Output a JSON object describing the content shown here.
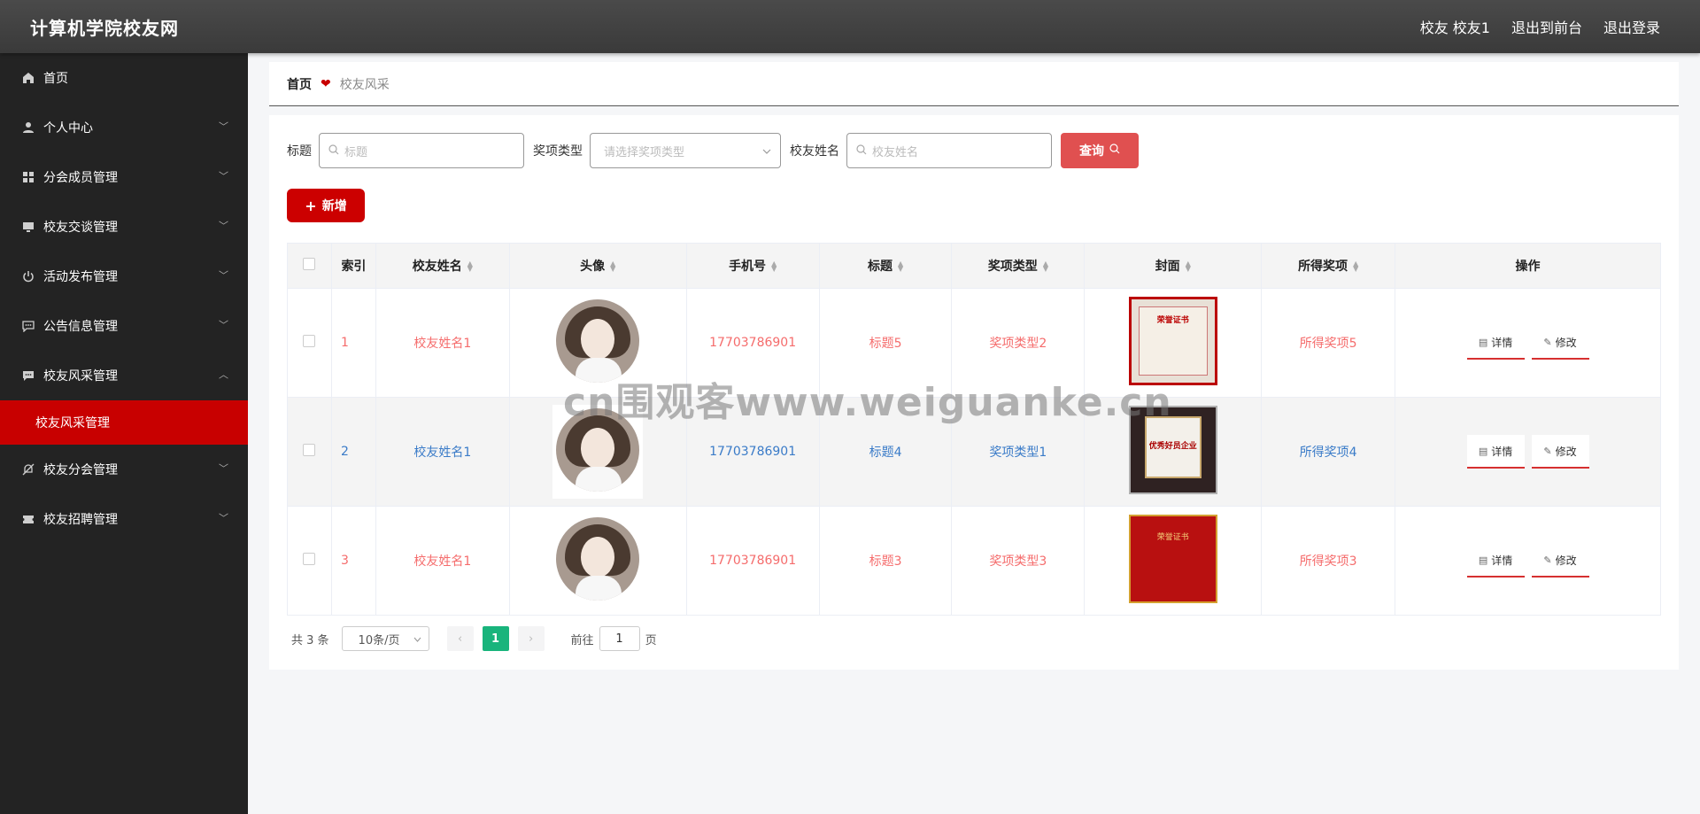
{
  "header": {
    "brand": "计算机学院校友网",
    "user_label": "校友 校友1",
    "to_front_label": "退出到前台",
    "logout_label": "退出登录"
  },
  "sidebar": {
    "items": [
      {
        "label": "首页",
        "icon": "home-icon"
      },
      {
        "label": "个人中心",
        "icon": "user-icon"
      },
      {
        "label": "分会成员管理",
        "icon": "grid-icon"
      },
      {
        "label": "校友交谈管理",
        "icon": "monitor-icon"
      },
      {
        "label": "活动发布管理",
        "icon": "power-icon"
      },
      {
        "label": "公告信息管理",
        "icon": "chat-icon"
      },
      {
        "label": "校友风采管理",
        "icon": "message-icon"
      },
      {
        "label": "校友分会管理",
        "icon": "bell-off-icon"
      },
      {
        "label": "校友招聘管理",
        "icon": "ticket-icon"
      }
    ],
    "active_sub": "校友风采管理"
  },
  "breadcrumb": {
    "home": "首页",
    "current": "校友风采"
  },
  "search": {
    "title_label": "标题",
    "title_placeholder": "标题",
    "award_type_label": "奖项类型",
    "award_type_placeholder": "请选择奖项类型",
    "name_label": "校友姓名",
    "name_placeholder": "校友姓名",
    "query_label": "查询"
  },
  "add_label": "新增",
  "table": {
    "headers": [
      "索引",
      "校友姓名",
      "头像",
      "手机号",
      "标题",
      "奖项类型",
      "封面",
      "所得奖项",
      "操作"
    ],
    "rows": [
      {
        "index": "1",
        "name": "校友姓名1",
        "phone": "17703786901",
        "title": "标题5",
        "award_type": "奖项类型2",
        "award": "所得奖项5",
        "cover_text": "荣誉证书"
      },
      {
        "index": "2",
        "name": "校友姓名1",
        "phone": "17703786901",
        "title": "标题4",
        "award_type": "奖项类型1",
        "award": "所得奖项4",
        "cover_text": "优秀好员企业"
      },
      {
        "index": "3",
        "name": "校友姓名1",
        "phone": "17703786901",
        "title": "标题3",
        "award_type": "奖项类型3",
        "award": "所得奖项3",
        "cover_text": "荣誉证书"
      }
    ],
    "detail_label": "详情",
    "edit_label": "修改"
  },
  "pagination": {
    "total": "共 3 条",
    "page_size": "10条/页",
    "current_page": "1",
    "goto_label": "前往",
    "goto_value": "1",
    "page_suffix": "页"
  },
  "watermark": "cn围观客www.weiguanke.cn",
  "colors": {
    "accent": "#c80000",
    "link_red": "#f56c6c",
    "link_blue": "#3a7bc8",
    "pager_active": "#19b47c"
  }
}
